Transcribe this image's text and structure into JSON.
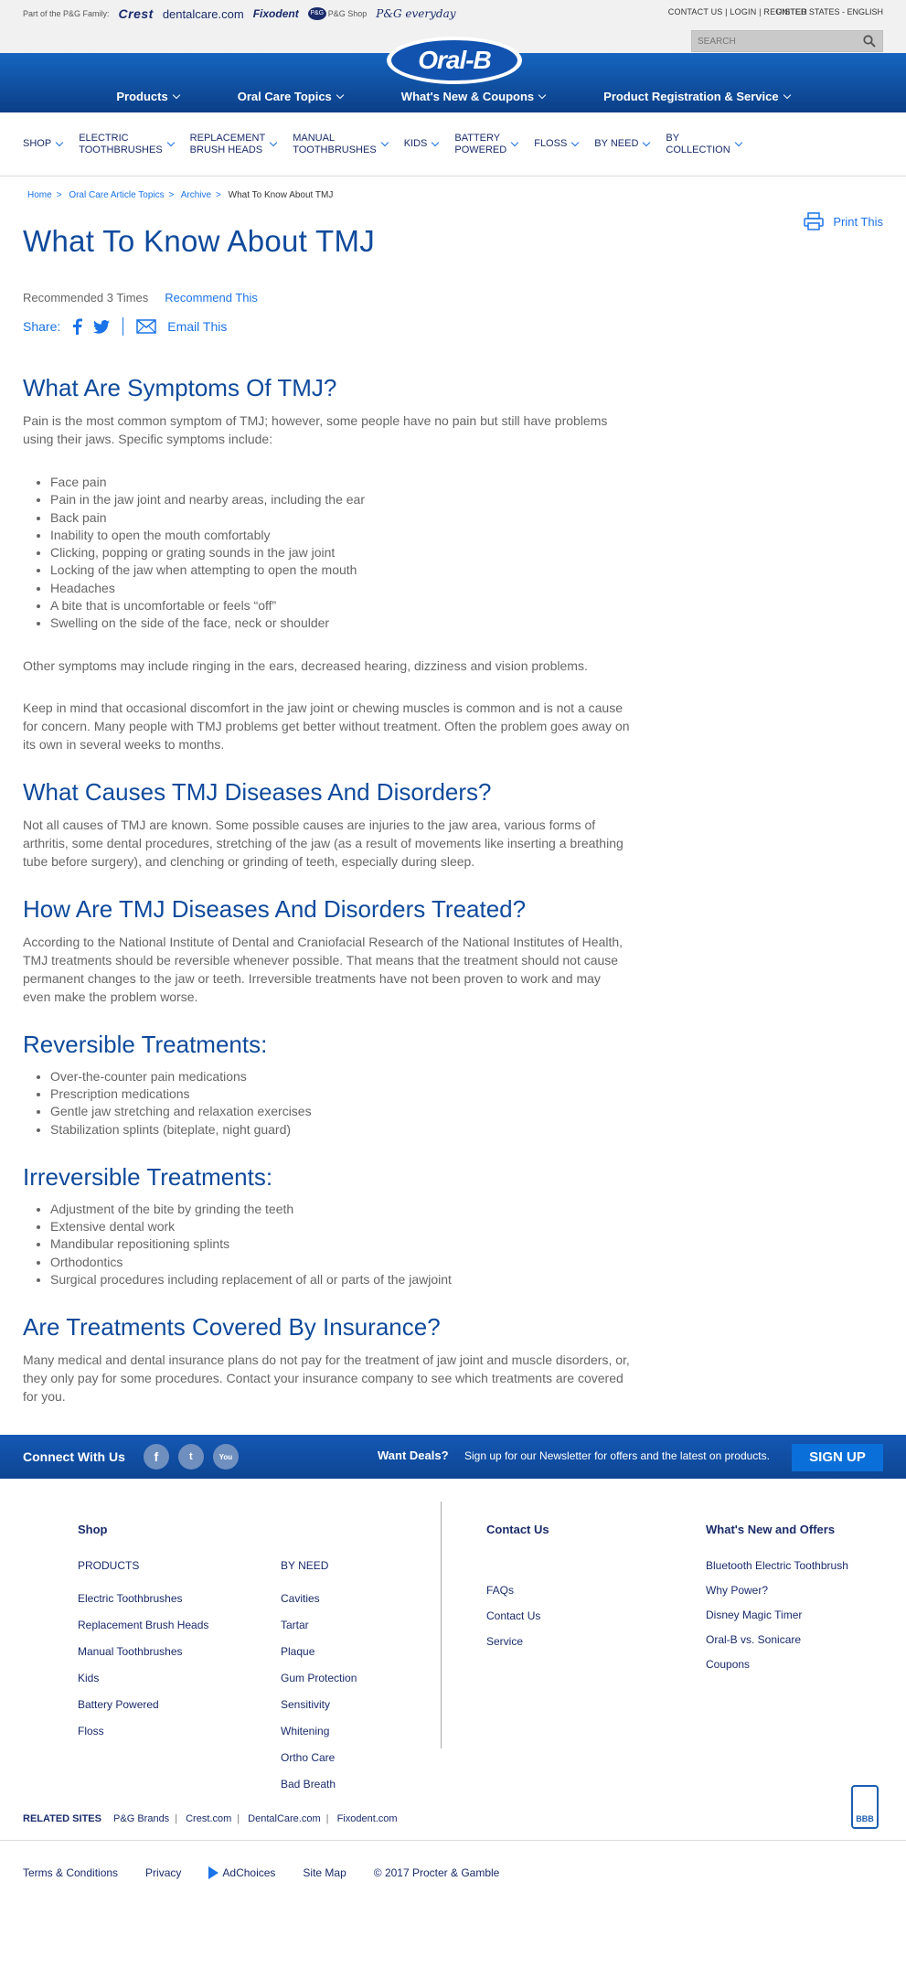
{
  "utility": {
    "part_of": "Part of the P&G Family:",
    "brands": [
      "Crest",
      "dentalcare.com",
      "Fixodent",
      "P&G Shop",
      "P&G everyday"
    ],
    "contact": "CONTACT US",
    "login": "LOGIN",
    "register": "REGISTER",
    "region": "UNITED STATES - ENGLISH",
    "search_placeholder": "SEARCH"
  },
  "logo_text": "Oral-B",
  "main_nav": [
    "Products",
    "Oral Care Topics",
    "What's New & Coupons",
    "Product Registration & Service"
  ],
  "sub_nav": [
    {
      "line1": "SHOP",
      "line2": ""
    },
    {
      "line1": "ELECTRIC",
      "line2": "TOOTHBRUSHES"
    },
    {
      "line1": "REPLACEMENT",
      "line2": "BRUSH HEADS"
    },
    {
      "line1": "MANUAL",
      "line2": "TOOTHBRUSHES"
    },
    {
      "line1": "KIDS",
      "line2": ""
    },
    {
      "line1": "BATTERY",
      "line2": "POWERED"
    },
    {
      "line1": "FLOSS",
      "line2": ""
    },
    {
      "line1": "BY NEED",
      "line2": ""
    },
    {
      "line1": "BY",
      "line2": "COLLECTION"
    }
  ],
  "breadcrumb": [
    "Home",
    "Oral Care Article Topics",
    "Archive",
    "What To Know About TMJ"
  ],
  "print_label": "Print This",
  "title": "What To Know About TMJ",
  "recommended": "Recommended 3 Times",
  "recommend_link": "Recommend This",
  "share_label": "Share:",
  "email_label": "Email This",
  "s1": {
    "heading": "What Are Symptoms Of TMJ?",
    "intro": "Pain is the most common symptom of TMJ; however, some people have no pain but still have problems using their jaws. Specific symptoms include:",
    "items": [
      "Face pain",
      "Pain in the jaw joint and nearby areas, including the ear",
      "Back pain",
      "Inability to open the mouth comfortably",
      "Clicking, popping or grating sounds in the jaw joint",
      "Locking of the jaw when attempting to open the mouth",
      "Headaches",
      "A bite that is uncomfortable or feels “off”",
      "Swelling on the side of the face, neck or shoulder"
    ],
    "p2": "Other symptoms may include ringing in the ears, decreased hearing, dizziness and vision problems.",
    "p3": "Keep in mind that occasional discomfort in the jaw joint or chewing muscles is common and is not a cause for concern. Many people with TMJ problems get better without treatment. Often the problem goes away on its own in several weeks to months."
  },
  "s2": {
    "heading": "What Causes TMJ Diseases And Disorders?",
    "p": "Not all causes of TMJ are known. Some possible causes are injuries to the jaw area, various forms of arthritis, some dental procedures, stretching of the jaw (as a result of movements like inserting a breathing tube before surgery), and clenching or grinding of teeth, especially during sleep."
  },
  "s3": {
    "heading": "How Are TMJ Diseases And Disorders Treated?",
    "p": "According to the National Institute of Dental and Craniofacial Research of the National Institutes of Health, TMJ treatments should be reversible whenever possible. That means that the treatment should not cause permanent changes to the jaw or teeth. Irreversible treatments have not been proven to work and may even make the problem worse."
  },
  "s4": {
    "heading": "Reversible Treatments:",
    "items": [
      "Over-the-counter pain medications",
      "Prescription medications",
      "Gentle jaw stretching and relaxation exercises",
      "Stabilization splints (biteplate, night guard)"
    ]
  },
  "s5": {
    "heading": "Irreversible Treatments:",
    "items": [
      "Adjustment of the bite by grinding the teeth",
      "Extensive dental work",
      "Mandibular repositioning splints",
      "Orthodontics",
      "Surgical procedures including replacement of all or parts of the jawjoint"
    ]
  },
  "s6": {
    "heading": "Are Treatments Covered By Insurance?",
    "p": "Many medical and dental insurance plans do not pay for the treatment of jaw joint and muscle disorders, or, they only pay for some procedures. Contact your insurance company to see which treatments are covered for you."
  },
  "connect": {
    "title": "Connect With Us",
    "deals": "Want Deals?",
    "deals_text": "Sign up for our Newsletter for offers and the latest on products.",
    "signup": "SIGN UP"
  },
  "footer": {
    "shop_heading": "Shop",
    "products_heading": "PRODUCTS",
    "products": [
      "Electric Toothbrushes",
      "Replacement Brush Heads",
      "Manual Toothbrushes",
      "Kids",
      "Battery Powered",
      "Floss"
    ],
    "byneed_heading": "BY NEED",
    "byneed": [
      "Cavities",
      "Tartar",
      "Plaque",
      "Gum Protection",
      "Sensitivity",
      "Whitening",
      "Ortho Care",
      "Bad Breath"
    ],
    "contact_heading": "Contact Us",
    "contact": [
      "FAQs",
      "Contact Us",
      "Service"
    ],
    "new_heading": "What's New and Offers",
    "new": [
      "Bluetooth Electric Toothbrush",
      "Why Power?",
      "Disney Magic Timer",
      "Oral-B vs. Sonicare",
      "Coupons"
    ],
    "related_label": "RELATED SITES",
    "related": [
      "P&G Brands",
      "Crest.com",
      "DentalCare.com",
      "Fixodent.com"
    ],
    "bbb": "BBB"
  },
  "bottom": {
    "terms": "Terms & Conditions",
    "privacy": "Privacy",
    "adchoices": "AdChoices",
    "sitemap": "Site Map",
    "copyright": "© 2017 Procter & Gamble"
  }
}
